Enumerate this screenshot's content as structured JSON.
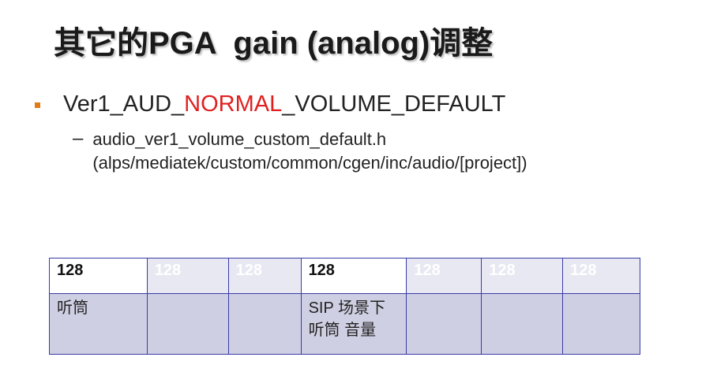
{
  "title": "其它的PGA  gain (analog)调整",
  "bullet": {
    "prefix": "Ver1_AUD_",
    "highlight": "NORMAL",
    "suffix": "_VOLUME_DEFAULT",
    "highlight_color": "#e02020",
    "bullet_color": "#e07b1a"
  },
  "sub_bullet": {
    "dash": "–",
    "line1": "audio_ver1_volume_custom_default.h",
    "line2": "(alps/mediatek/custom/common/cgen/inc/audio/[project])"
  },
  "table": {
    "row1": [
      "128",
      "128",
      "128",
      "128",
      "128",
      "128",
      "128"
    ],
    "row2_cell1": "听筒",
    "row2_cell4_line1": "SIP 场景下",
    "row2_cell4_line2": "听筒 音量"
  }
}
